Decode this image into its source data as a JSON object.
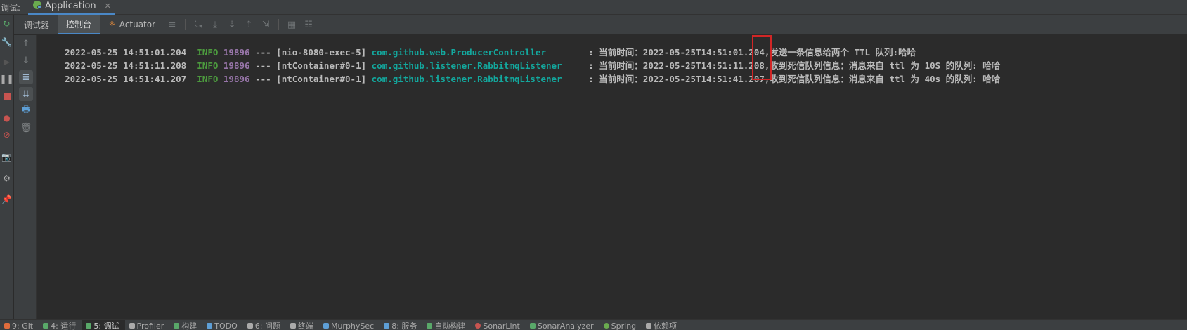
{
  "topbar": {
    "label": "调试:",
    "tab_title": "Application",
    "tab_close": "✕"
  },
  "subtabs": {
    "debugger": "调试器",
    "console": "控制台",
    "actuator": "Actuator"
  },
  "console": {
    "lines": [
      {
        "date": "2022-05-25 14:51:01.204",
        "level": "INFO",
        "pid": "19896",
        "dashes": "---",
        "thread": "[nio-8080-exec-5]",
        "logger": "com.github.web.ProducerController",
        "colon": ":",
        "message": "当前时间：2022-05-25T14:51:01.204,发送一条信息给两个 TTL 队列:哈哈"
      },
      {
        "date": "2022-05-25 14:51:11.208",
        "level": "INFO",
        "pid": "19896",
        "dashes": "---",
        "thread": "[ntContainer#0-1]",
        "logger": "com.github.listener.RabbitmqListener",
        "colon": ":",
        "message": "当前时间：2022-05-25T14:51:11.208,收到死信队列信息：消息来自 ttl 为 10S 的队列: 哈哈"
      },
      {
        "date": "2022-05-25 14:51:41.207",
        "level": "INFO",
        "pid": "19896",
        "dashes": "---",
        "thread": "[ntContainer#0-1]",
        "logger": "com.github.listener.RabbitmqListener",
        "colon": ":",
        "message": "当前时间：2022-05-25T14:51:41.207,收到死信队列信息：消息来自 ttl 为 40s 的队列: 哈哈"
      }
    ]
  },
  "bottombar": {
    "items": [
      {
        "label": "9: Git",
        "icon": "git-icon"
      },
      {
        "label": "4: 运行",
        "icon": "run-icon"
      },
      {
        "label": "5: 调试",
        "icon": "debug-icon"
      },
      {
        "label": "Profiler",
        "icon": "profiler-icon"
      },
      {
        "label": "构建",
        "icon": "build-icon"
      },
      {
        "label": "TODO",
        "icon": "todo-icon"
      },
      {
        "label": "6: 问题",
        "icon": "problems-icon"
      },
      {
        "label": "终端",
        "icon": "terminal-icon"
      },
      {
        "label": "MurphySec",
        "icon": "murphysec-icon"
      },
      {
        "label": "8: 服务",
        "icon": "services-icon"
      },
      {
        "label": "自动构建",
        "icon": "autobuild-icon"
      },
      {
        "label": "SonarLint",
        "icon": "sonarlint-icon"
      },
      {
        "label": "SonarAnalyzer",
        "icon": "sonaranalyzer-icon"
      },
      {
        "label": "Spring",
        "icon": "spring-icon"
      },
      {
        "label": "依赖项",
        "icon": "dependencies-icon"
      }
    ]
  },
  "colors": {
    "accent": "#4a88c7",
    "info": "#4c9a3e",
    "pid": "#9876aa",
    "logger": "#13a89e",
    "highlight_box": "#d12626"
  }
}
